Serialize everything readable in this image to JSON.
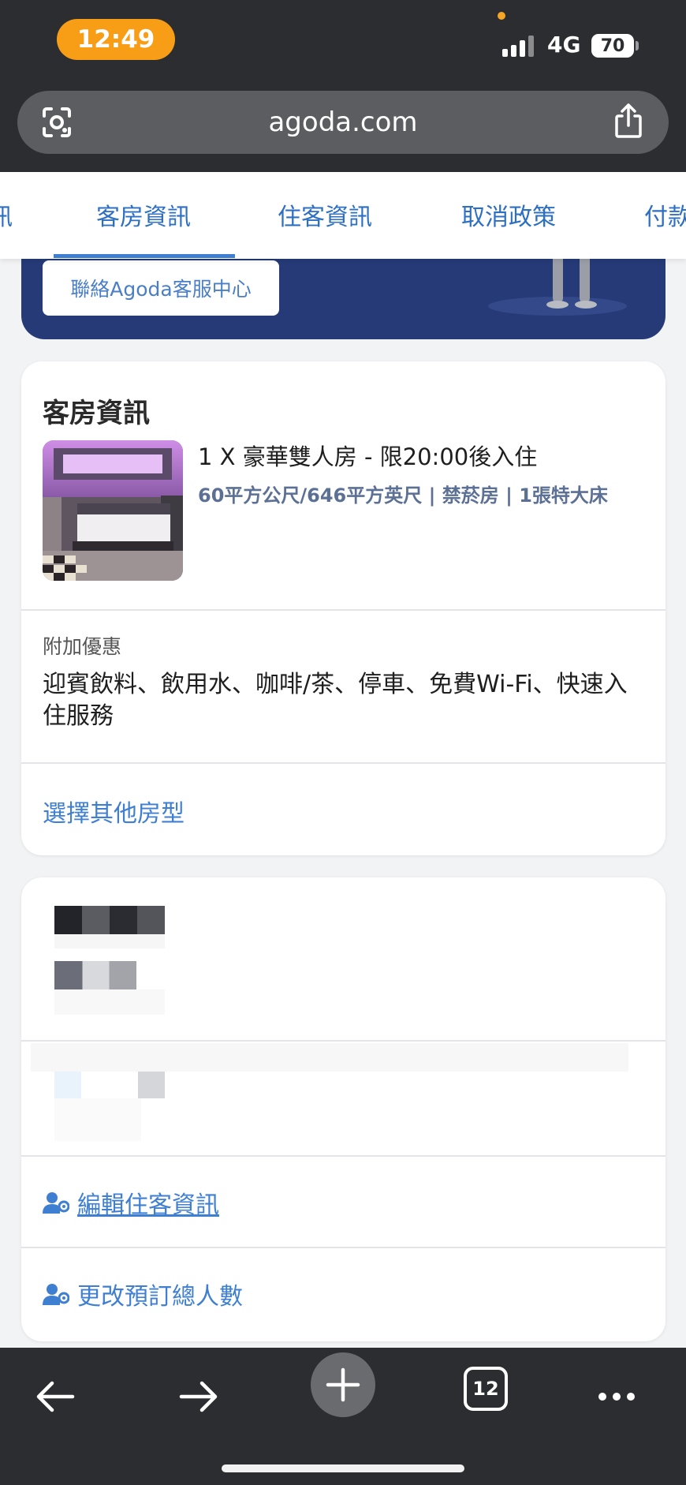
{
  "status_bar": {
    "time": "12:49",
    "network": "4G",
    "battery": "70"
  },
  "browser": {
    "url": "agoda.com",
    "tab_count": "12"
  },
  "tabs": [
    {
      "label": "訊"
    },
    {
      "label": "客房資訊"
    },
    {
      "label": "住客資訊"
    },
    {
      "label": "取消政策"
    },
    {
      "label": "付款"
    }
  ],
  "banner": {
    "support_button": "聯絡Agoda客服中心"
  },
  "room_card": {
    "title": "客房資訊",
    "room_name": "1 X 豪華雙人房 - 限20:00後入住",
    "room_specs": "60平方公尺/646平方英尺 | 禁菸房 | 1張特大床",
    "perks_label": "附加優惠",
    "perks": "迎賓飲料、飲用水、咖啡/茶、停車、免費Wi-Fi、快速入住服務",
    "change_room_link": "選擇其他房型"
  },
  "guest_card": {
    "edit_guest_link": "編輯住客資訊",
    "change_guests_link": "更改預訂總人數"
  },
  "colors": {
    "accent": "#3f7fd1",
    "banner": "#253a77",
    "time_pill": "#f79d16",
    "chrome": "#2c2d30"
  }
}
